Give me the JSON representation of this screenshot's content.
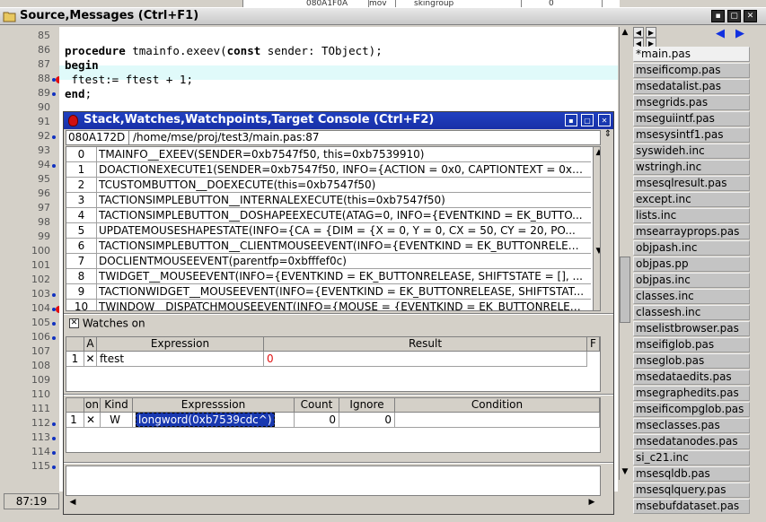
{
  "source_window": {
    "title": "Source,Messages (Ctrl+F1)",
    "status": "87:19",
    "lines": [
      {
        "num": "85",
        "code": "",
        "mark": false,
        "bp": false
      },
      {
        "num": "86",
        "code": "procedure tmainfo.exeev(const sender: TObject);",
        "mark": false,
        "bp": false
      },
      {
        "num": "87",
        "code": "begin",
        "mark": false,
        "bp": false
      },
      {
        "num": "88",
        "code": " ftest:= ftest + 1;",
        "mark": true,
        "bp": true
      },
      {
        "num": "89",
        "code": "end;",
        "mark": true,
        "bp": false
      },
      {
        "num": "90",
        "code": "",
        "mark": false,
        "bp": false
      },
      {
        "num": "91",
        "code": "",
        "mark": false,
        "bp": false
      },
      {
        "num": "92",
        "code": "",
        "mark": true,
        "bp": false
      },
      {
        "num": "93",
        "code": "",
        "mark": false,
        "bp": false
      },
      {
        "num": "94",
        "code": "",
        "mark": true,
        "bp": false
      },
      {
        "num": "95",
        "code": "",
        "mark": false,
        "bp": false
      },
      {
        "num": "96",
        "code": "",
        "mark": false,
        "bp": false
      },
      {
        "num": "97",
        "code": "",
        "mark": false,
        "bp": false
      },
      {
        "num": "98",
        "code": "",
        "mark": false,
        "bp": false
      },
      {
        "num": "99",
        "code": "",
        "mark": false,
        "bp": false
      },
      {
        "num": "100",
        "code": "",
        "mark": false,
        "bp": false
      },
      {
        "num": "101",
        "code": "",
        "mark": false,
        "bp": false
      },
      {
        "num": "102",
        "code": "",
        "mark": false,
        "bp": false
      },
      {
        "num": "103",
        "code": "",
        "mark": true,
        "bp": false
      },
      {
        "num": "104",
        "code": "",
        "mark": true,
        "bp": true
      },
      {
        "num": "105",
        "code": "",
        "mark": true,
        "bp": false
      },
      {
        "num": "106",
        "code": "",
        "mark": true,
        "bp": false
      },
      {
        "num": "107",
        "code": "",
        "mark": false,
        "bp": false
      },
      {
        "num": "108",
        "code": "",
        "mark": false,
        "bp": false
      },
      {
        "num": "109",
        "code": "",
        "mark": false,
        "bp": false
      },
      {
        "num": "110",
        "code": "",
        "mark": false,
        "bp": false
      },
      {
        "num": "111",
        "code": "",
        "mark": false,
        "bp": false
      },
      {
        "num": "112",
        "code": "",
        "mark": true,
        "bp": false
      },
      {
        "num": "113",
        "code": "",
        "mark": true,
        "bp": false
      },
      {
        "num": "114",
        "code": "",
        "mark": true,
        "bp": false
      },
      {
        "num": "115",
        "code": "",
        "mark": true,
        "bp": false
      }
    ]
  },
  "background_grid": {
    "cells": [
      "080A1F0A",
      "mov",
      "skingroup",
      "0"
    ]
  },
  "files": [
    "*main.pas",
    "mseificomp.pas",
    "msedatalist.pas",
    "msegrids.pas",
    "mseguiintf.pas",
    "msesysintf1.pas",
    "syswideh.inc",
    "wstringh.inc",
    "msesqlresult.pas",
    "except.inc",
    "lists.inc",
    "msearrayprops.pas",
    "objpash.inc",
    "objpas.pp",
    "objpas.inc",
    "classes.inc",
    "classesh.inc",
    "mselistbrowser.pas",
    "mseifiglob.pas",
    "mseglob.pas",
    "msedataedits.pas",
    "msegraphedits.pas",
    "mseificompglob.pas",
    "mseclasses.pas",
    "msedatanodes.pas",
    "si_c21.inc",
    "msesqldb.pas",
    "msesqlquery.pas",
    "msebufdataset.pas"
  ],
  "stack_window": {
    "title": "Stack,Watches,Watchpoints,Target Console (Ctrl+F2)",
    "address": "080A172D",
    "path": "/home/mse/proj/test3/main.pas:87",
    "frames": [
      {
        "idx": "0",
        "text": "TMAINFO__EXEEV(SENDER=0xb7547f50, this=0xb7539910)"
      },
      {
        "idx": "1",
        "text": "DOACTIONEXECUTE1(SENDER=0xb7547f50, INFO={ACTION = 0x0, CAPTIONTEXT = 0x0..."
      },
      {
        "idx": "2",
        "text": "TCUSTOMBUTTON__DOEXECUTE(this=0xb7547f50)"
      },
      {
        "idx": "3",
        "text": "TACTIONSIMPLEBUTTON__INTERNALEXECUTE(this=0xb7547f50)"
      },
      {
        "idx": "4",
        "text": "TACTIONSIMPLEBUTTON__DOSHAPEEXECUTE(ATAG=0, INFO={EVENTKIND = EK_BUTTO..."
      },
      {
        "idx": "5",
        "text": "UPDATEMOUSESHAPESTATE(INFO={CA = {DIM = {X = 0, Y = 0, CX = 50, CY = 20, PO..."
      },
      {
        "idx": "6",
        "text": "TACTIONSIMPLEBUTTON__CLIENTMOUSEEVENT(INFO={EVENTKIND = EK_BUTTONRELEA..."
      },
      {
        "idx": "7",
        "text": "DOCLIENTMOUSEEVENT(parentfp=0xbfffef0c)"
      },
      {
        "idx": "8",
        "text": "TWIDGET__MOUSEEVENT(INFO={EVENTKIND = EK_BUTTONRELEASE, SHIFTSTATE = [], ..."
      },
      {
        "idx": "9",
        "text": "TACTIONWIDGET__MOUSEEVENT(INFO={EVENTKIND = EK_BUTTONRELEASE, SHIFTSTAT..."
      },
      {
        "idx": "10",
        "text": "TWINDOW__DISPATCHMOUSEEVENT(INFO={MOUSE = {EVENTKIND = EK_BUTTONRELEA..."
      }
    ],
    "watches_on_label": "Watches on",
    "watches_on_checked": "✕",
    "watch_headers": {
      "a": "A",
      "expression": "Expression",
      "result": "Result",
      "f": "F"
    },
    "watches": [
      {
        "num": "1",
        "active": "✕",
        "expression": "ftest",
        "result": "0"
      }
    ],
    "wp_headers": {
      "on": "on",
      "kind": "Kind",
      "expression": "Expresssion",
      "count": "Count",
      "ignore": "Ignore",
      "condition": "Condition"
    },
    "watchpoints": [
      {
        "num": "1",
        "on": "✕",
        "kind": "W",
        "expression": "longword(0xb7539cdc^)",
        "count": "0",
        "ignore": "0",
        "condition": ""
      }
    ]
  },
  "colors": {
    "titlebar_active": "#1838b0",
    "highlight_line": "#e0fafa",
    "breakpoint": "#e01010",
    "line_marker": "#1030c0",
    "result_value": "#e01010"
  }
}
